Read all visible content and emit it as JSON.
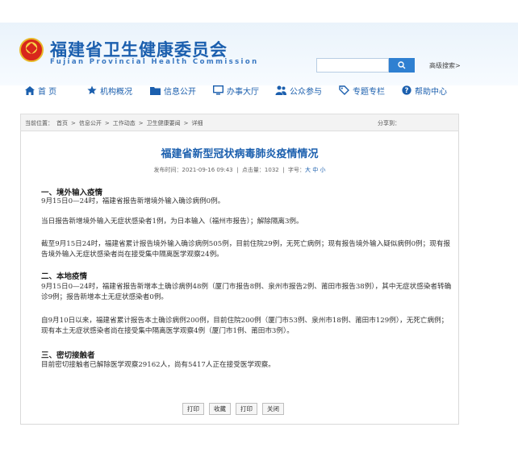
{
  "header": {
    "title": "福建省卫生健康委员会",
    "subtitle": "Fujian Provincial Health Commission",
    "search_placeholder": "",
    "advanced_search": "高级搜索>"
  },
  "nav": {
    "items": [
      {
        "label": "首 页",
        "icon": "home-icon"
      },
      {
        "label": "机构概况",
        "icon": "star-icon"
      },
      {
        "label": "信息公开",
        "icon": "folder-icon"
      },
      {
        "label": "办事大厅",
        "icon": "monitor-icon"
      },
      {
        "label": "公众参与",
        "icon": "people-icon"
      },
      {
        "label": "专题专栏",
        "icon": "tag-icon"
      },
      {
        "label": "帮助中心",
        "icon": "help-icon"
      }
    ]
  },
  "breadcrumb": {
    "prefix": "当前位置：",
    "items": [
      "首页",
      "信息公开",
      "工作动态",
      "卫生健康要闻",
      "详细"
    ],
    "separator": ">",
    "share": "分享到："
  },
  "article": {
    "title": "福建省新型冠状病毒肺炎疫情情况",
    "meta_date": "发布时间：2021-09-16 09:43",
    "meta_views": "点击量：1032",
    "meta_size_label": "字号：",
    "meta_size_links": "大 中 小",
    "sections": [
      {
        "heading": "一、境外输入疫情",
        "paragraphs": [
          "9月15日0—24时，福建省报告新增境外输入确诊病例0例。",
          "当日报告新增境外输入无症状感染者1例，为日本输入（福州市报告）；解除隔离3例。",
          "截至9月15日24时，福建省累计报告境外输入确诊病例505例，目前住院29例，无死亡病例；现有报告境外输入疑似病例0例；现有报告境外输入无症状感染者尚在接受集中隔离医学观察24例。"
        ]
      },
      {
        "heading": "二、本地疫情",
        "paragraphs": [
          "9月15日0—24时，福建省报告新增本土确诊病例48例（厦门市报告8例、泉州市报告2例、莆田市报告38例），其中无症状感染者转确诊9例；报告新增本土无症状感染者0例。",
          "自9月10日以来，福建省累计报告本土确诊病例200例，目前住院200例（厦门市53例、泉州市18例、莆田市129例），无死亡病例；现有本土无症状感染者尚在接受集中隔离医学观察4例（厦门市1例、莆田市3例）。"
        ]
      },
      {
        "heading": "三、密切接触者",
        "paragraphs": [
          "目前密切接触者已解除医学观察29162人，尚有5417人正在接受医学观察。"
        ]
      }
    ]
  },
  "actions": {
    "items": [
      "打印",
      "收藏",
      "打印",
      "关闭"
    ]
  },
  "colors": {
    "brand_blue": "#1b5fae",
    "search_blue": "#2f80d1"
  }
}
